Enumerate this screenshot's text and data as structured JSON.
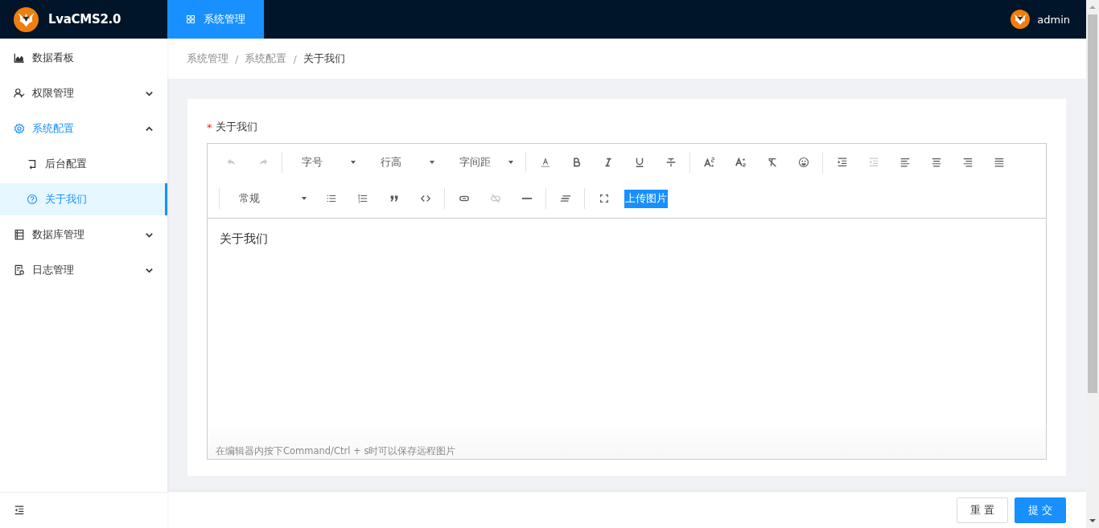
{
  "header": {
    "brand": "LvaCMS2.0",
    "tabs": [
      {
        "label": "系统管理",
        "selected": true
      }
    ],
    "user": "admin"
  },
  "sidebar": {
    "items": [
      {
        "kind": "link",
        "label": "数据看板",
        "selected": false
      },
      {
        "kind": "group",
        "label": "权限管理",
        "selected": false,
        "expanded": false
      },
      {
        "kind": "group",
        "label": "系统配置",
        "selected": true,
        "expanded": true,
        "children": [
          {
            "label": "后台配置",
            "selected": false
          },
          {
            "label": "关于我们",
            "selected": true
          }
        ]
      },
      {
        "kind": "group",
        "label": "数据库管理",
        "selected": false,
        "expanded": false
      },
      {
        "kind": "group",
        "label": "日志管理",
        "selected": false,
        "expanded": false
      }
    ]
  },
  "breadcrumb": [
    {
      "label": "系统管理"
    },
    {
      "separator": "/",
      "label": "系统配置"
    },
    {
      "separator": "/",
      "label": "关于我们"
    }
  ],
  "form": {
    "label": "关于我们",
    "required_mark": "*",
    "toolbar": [
      [
        {
          "kind": "icon",
          "disabled": true
        },
        {
          "kind": "icon",
          "disabled": true
        },
        {
          "kind": "divider"
        },
        {
          "kind": "select",
          "label": "字号"
        },
        {
          "kind": "select",
          "label": "行高"
        },
        {
          "kind": "select",
          "label": "字间距"
        },
        {
          "kind": "divider"
        },
        {
          "kind": "icon",
          "disabled": false
        },
        {
          "kind": "icon",
          "disabled": false
        },
        {
          "kind": "icon",
          "disabled": false
        },
        {
          "kind": "icon",
          "disabled": false
        },
        {
          "kind": "icon",
          "disabled": false
        },
        {
          "kind": "divider"
        },
        {
          "kind": "icon",
          "disabled": false
        },
        {
          "kind": "icon",
          "disabled": false
        },
        {
          "kind": "icon",
          "disabled": false
        },
        {
          "kind": "icon",
          "disabled": false
        },
        {
          "kind": "divider"
        },
        {
          "kind": "icon",
          "disabled": false
        },
        {
          "kind": "icon",
          "disabled": true
        },
        {
          "kind": "icon",
          "disabled": false
        },
        {
          "kind": "icon",
          "disabled": false
        },
        {
          "kind": "icon",
          "disabled": false
        },
        {
          "kind": "icon",
          "disabled": false
        }
      ],
      [
        {
          "kind": "divider"
        },
        {
          "kind": "select",
          "label": "常规"
        },
        {
          "kind": "icon",
          "disabled": false
        },
        {
          "kind": "icon",
          "disabled": false
        },
        {
          "kind": "icon",
          "disabled": false
        },
        {
          "kind": "icon",
          "disabled": false
        },
        {
          "kind": "divider"
        },
        {
          "kind": "icon",
          "disabled": false
        },
        {
          "kind": "icon",
          "disabled": true
        },
        {
          "kind": "icon",
          "disabled": false
        },
        {
          "kind": "divider"
        },
        {
          "kind": "icon",
          "disabled": false
        },
        {
          "kind": "divider"
        },
        {
          "kind": "icon",
          "disabled": false
        },
        {
          "kind": "button",
          "label": "上传图片"
        }
      ]
    ],
    "content": "关于我们",
    "hint": "在编辑器内按下Command/Ctrl + s时可以保存远程图片"
  },
  "buttons": [
    {
      "label": "重 置",
      "kind": "default"
    },
    {
      "label": "提 交",
      "kind": "primary"
    }
  ]
}
